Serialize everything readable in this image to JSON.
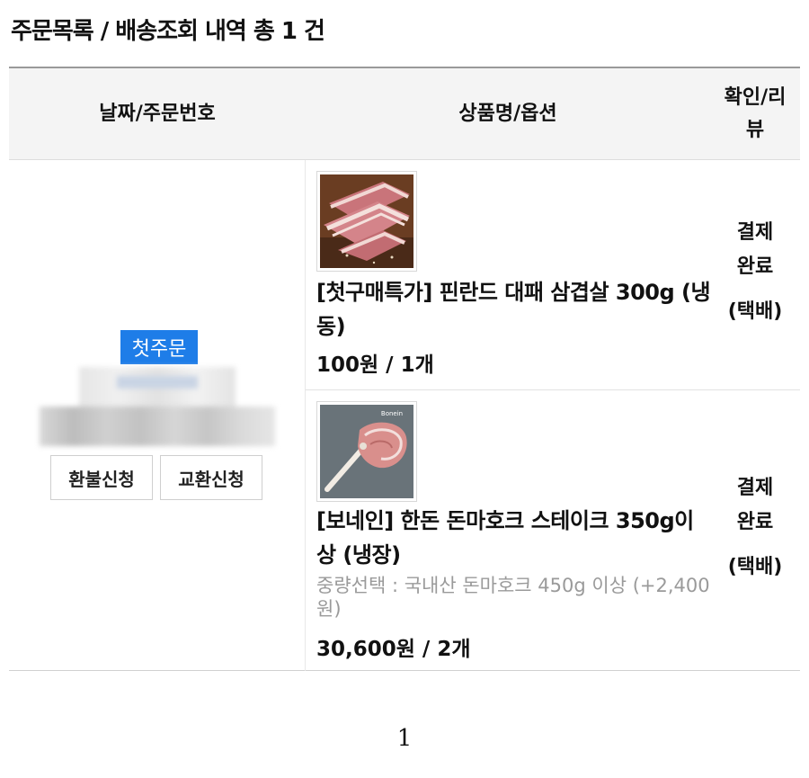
{
  "page": {
    "title": "주문목록 / 배송조회 내역 총 1 건"
  },
  "table": {
    "headers": {
      "date": "날짜/주문번호",
      "product": "상품명/옵션",
      "review": "확인/리뷰"
    }
  },
  "order": {
    "badge": "첫주문",
    "actions": {
      "refund": "환불신청",
      "exchange": "교환신청"
    },
    "items": [
      {
        "name": "[첫구매특가] 핀란드 대패 삼겹살 300g (냉동)",
        "option": "",
        "price": "100원 / 1개",
        "status": "결제완료",
        "status_line1": "결제",
        "status_line2": "완료",
        "delivery": "(택배)",
        "image_icon": "pork-belly-image"
      },
      {
        "name": "[보네인] 한돈 돈마호크 스테이크 350g이상 (냉장)",
        "option": "중량선택 : 국내산 돈마호크 450g 이상 (+2,400원)",
        "price": "30,600원 / 2개",
        "status": "결제완료",
        "status_line1": "결제",
        "status_line2": "완료",
        "delivery": "(택배)",
        "image_icon": "tomahawk-steak-image",
        "image_brand": "Bonein"
      }
    ]
  },
  "pagination": {
    "current_page": "1"
  }
}
